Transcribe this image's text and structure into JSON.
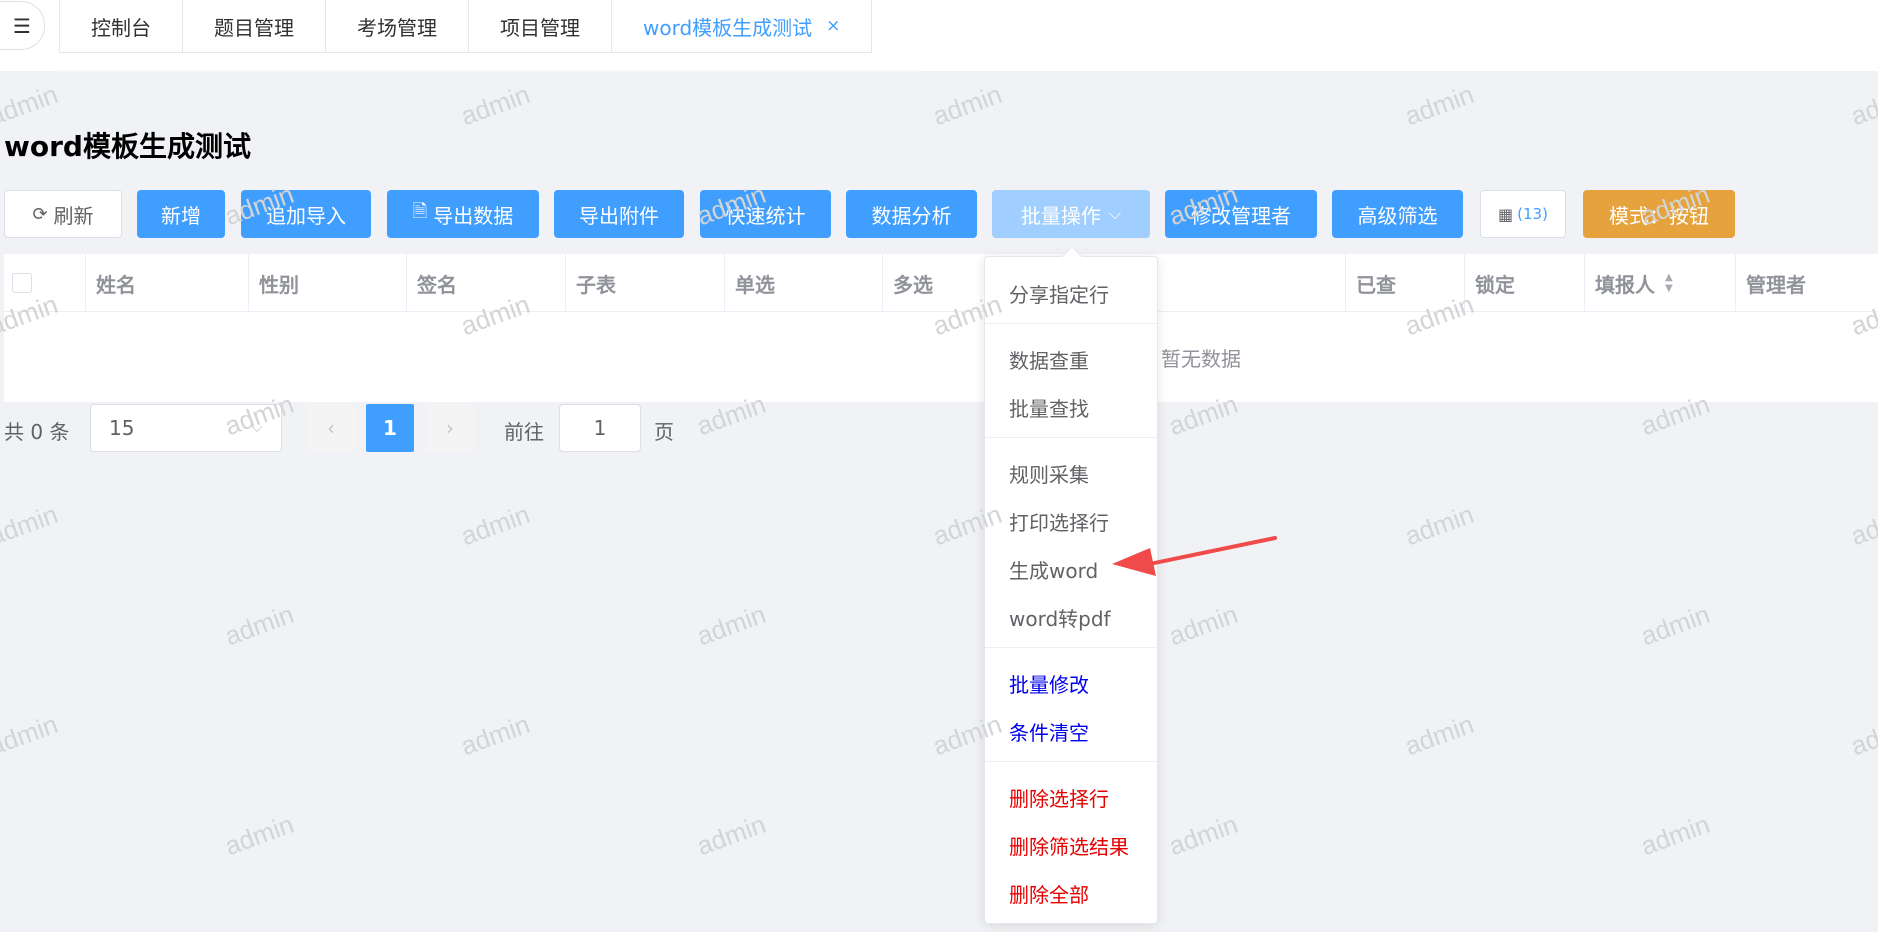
{
  "header": {
    "menu_icon": "menu-fold-icon",
    "tabs": [
      {
        "label": "控制台"
      },
      {
        "label": "题目管理"
      },
      {
        "label": "考场管理"
      },
      {
        "label": "项目管理"
      },
      {
        "label": "word模板生成测试",
        "active": true
      }
    ],
    "close_glyph": "×"
  },
  "page": {
    "title": "word模板生成测试"
  },
  "toolbar": {
    "refresh": "刷新",
    "add": "新增",
    "append_import": "追加导入",
    "export_data": "导出数据",
    "export_attachments": "导出附件",
    "quick_stats": "快速统计",
    "data_analysis": "数据分析",
    "batch_ops": "批量操作",
    "modify_admin": "修改管理者",
    "advanced_filter": "高级筛选",
    "columns_count": "(13)",
    "mode": "模式：按钮"
  },
  "table": {
    "columns": [
      "姓名",
      "性别",
      "签名",
      "子表",
      "单选",
      "多选",
      "已查",
      "锁定",
      "填报人",
      "管理者"
    ],
    "empty_text": "暂无数据"
  },
  "pagination": {
    "total": "共 0 条",
    "page_size": "15",
    "current_page": "1",
    "goto_label": "前往",
    "goto_value": "1",
    "page_suffix": "页"
  },
  "dropdown": {
    "items": [
      {
        "label": "分享指定行"
      },
      {
        "label": "数据查重"
      },
      {
        "label": "批量查找"
      },
      {
        "label": "规则采集"
      },
      {
        "label": "打印选择行"
      },
      {
        "label": "生成word"
      },
      {
        "label": "word转pdf"
      },
      {
        "label": "批量修改"
      },
      {
        "label": "条件清空"
      },
      {
        "label": "删除选择行"
      },
      {
        "label": "删除筛选结果"
      },
      {
        "label": "删除全部"
      }
    ]
  },
  "watermark": "admin",
  "colors": {
    "primary": "#409eff",
    "primary_light": "#a0cfff",
    "warning": "#e6a23c",
    "annotation_arrow": "#f04a4a",
    "blue_item": "#0000ee",
    "red_item": "#e60000"
  }
}
